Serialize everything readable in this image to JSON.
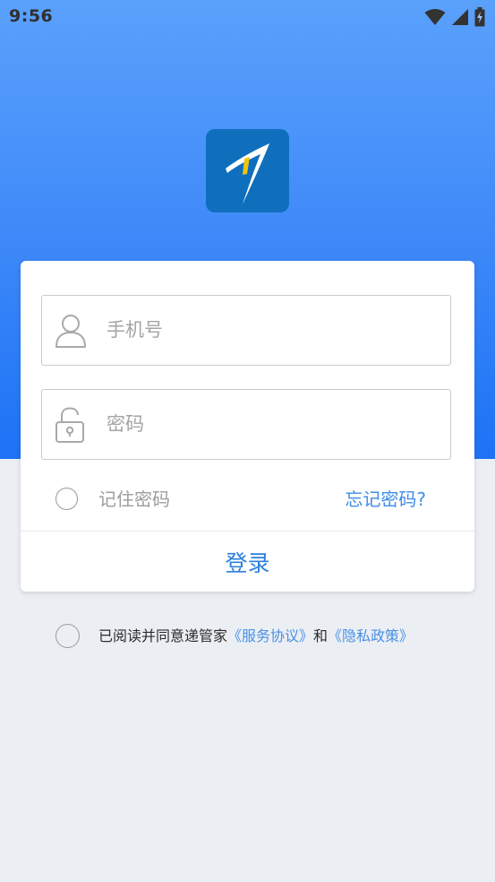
{
  "status_bar": {
    "time": "9:56",
    "icons": [
      "wifi-icon",
      "signal-icon",
      "battery-icon"
    ]
  },
  "colors": {
    "hero_gradient_top": "#5aa1fb",
    "hero_gradient_bottom": "#1d72f5",
    "page_background": "#ebeff4",
    "logo_background": "#0f6fbd",
    "accent_blue": "#2b80de",
    "link_blue": "#3e8de7"
  },
  "logo": {
    "icon": "app-logo-icon"
  },
  "login_form": {
    "phone_field": {
      "icon": "user-icon",
      "placeholder": "手机号",
      "value": ""
    },
    "password_field": {
      "icon": "lock-open-icon",
      "placeholder": "密码",
      "value": ""
    },
    "remember_password": {
      "label": "记住密码",
      "checked": false
    },
    "forgot_password_link": "忘记密码?",
    "login_button": "登录"
  },
  "agreement": {
    "checked": false,
    "prefix": "已阅读并同意递管家",
    "service_link": "《服务协议》",
    "connector": "和",
    "privacy_link": "《隐私政策》"
  }
}
